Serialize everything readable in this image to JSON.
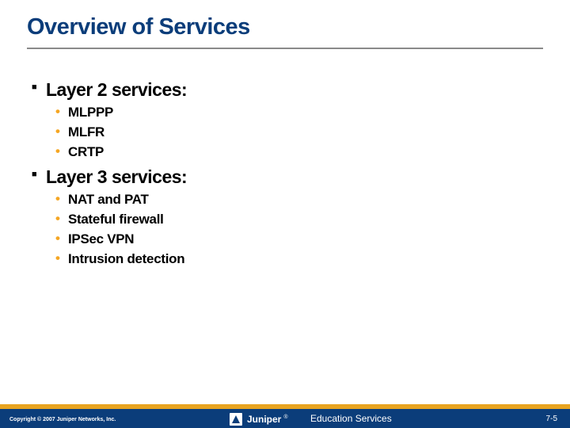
{
  "title": "Overview of Services",
  "sections": [
    {
      "heading": "Layer 2 services:",
      "items": [
        "MLPPP",
        "MLFR",
        "CRTP"
      ]
    },
    {
      "heading": "Layer 3 services:",
      "items": [
        "NAT and PAT",
        "Stateful firewall",
        "IPSec VPN",
        "Intrusion detection"
      ]
    }
  ],
  "footer": {
    "copyright": "Copyright © 2007 Juniper Networks, Inc.",
    "logo_text": "Juniper",
    "edu": "Education Services",
    "page": "7-5"
  }
}
